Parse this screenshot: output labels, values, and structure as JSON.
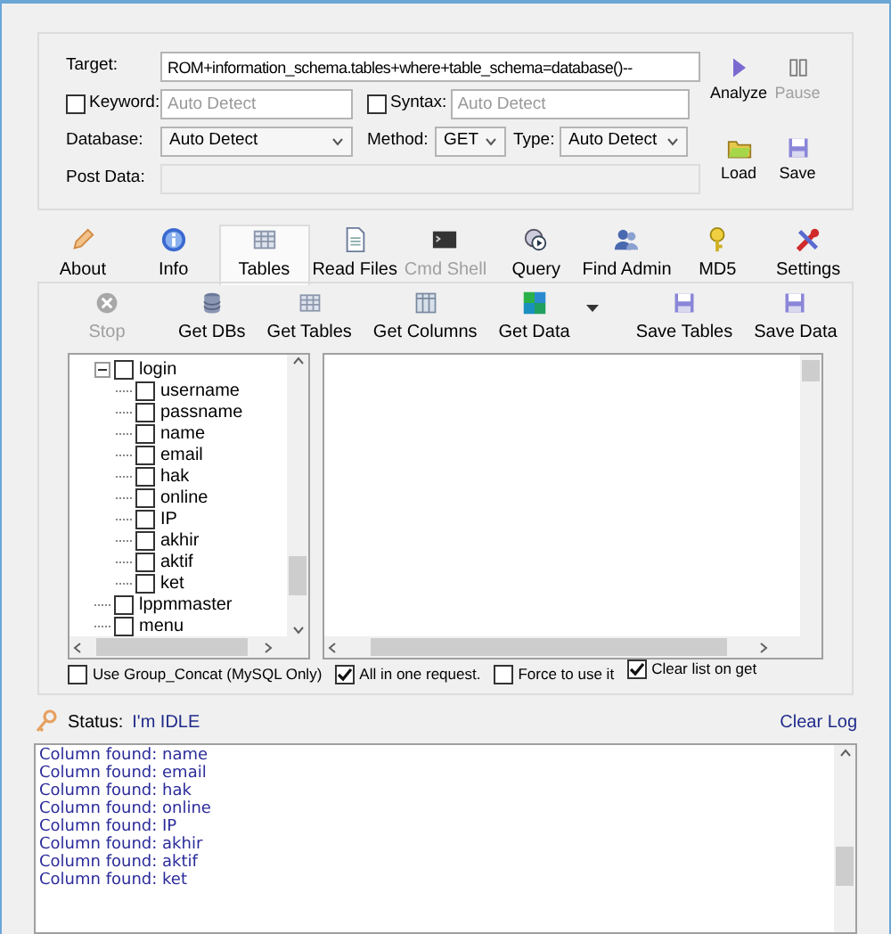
{
  "form": {
    "target": {
      "label": "Target:",
      "value": "ROM+information_schema.tables+where+table_schema=database()--"
    },
    "keyword": {
      "label": "Keyword:",
      "checked": false,
      "placeholder": "Auto Detect"
    },
    "syntax": {
      "label": "Syntax:",
      "checked": false,
      "placeholder": "Auto Detect"
    },
    "database": {
      "label": "Database:",
      "value": "Auto Detect"
    },
    "method": {
      "label": "Method:",
      "value": "GET"
    },
    "type": {
      "label": "Type:",
      "value": "Auto Detect"
    },
    "post_data": {
      "label": "Post Data:"
    }
  },
  "actions": [
    {
      "kind": "play",
      "label": "Analyze",
      "disabled": false
    },
    {
      "kind": "pause",
      "label": "Pause",
      "disabled": true
    },
    {
      "kind": "folder",
      "label": "Load",
      "disabled": false
    },
    {
      "kind": "floppy",
      "label": "Save",
      "disabled": false
    }
  ],
  "tabs": [
    {
      "kind": "about",
      "label": "About",
      "selected": false,
      "disabled": false
    },
    {
      "kind": "info",
      "label": "Info",
      "selected": false,
      "disabled": false
    },
    {
      "kind": "tables",
      "label": "Tables",
      "selected": true,
      "disabled": false
    },
    {
      "kind": "files",
      "label": "Read Files",
      "selected": false,
      "disabled": false
    },
    {
      "kind": "shell",
      "label": "Cmd Shell",
      "selected": false,
      "disabled": true
    },
    {
      "kind": "query",
      "label": "Query",
      "selected": false,
      "disabled": false
    },
    {
      "kind": "admin",
      "label": "Find Admin",
      "selected": false,
      "disabled": false
    },
    {
      "kind": "md5",
      "label": "MD5",
      "selected": false,
      "disabled": false
    },
    {
      "kind": "settings",
      "label": "Settings",
      "selected": false,
      "disabled": false
    }
  ],
  "toolbar": [
    {
      "buttons": [
        {
          "kind": "stop",
          "label": "Stop",
          "disabled": true
        }
      ]
    },
    {
      "buttons": [
        {
          "kind": "dbs",
          "label": "Get DBs",
          "disabled": false
        },
        {
          "kind": "tables",
          "label": "Get Tables",
          "disabled": false
        },
        {
          "kind": "columns",
          "label": "Get Columns",
          "disabled": false
        },
        {
          "kind": "data",
          "label": "Get Data",
          "disabled": false
        },
        {
          "kind": "dropdown",
          "disabled": false
        }
      ]
    },
    {
      "buttons": [
        {
          "kind": "floppy",
          "label": "Save Tables",
          "disabled": false
        },
        {
          "kind": "floppy",
          "label": "Save Data",
          "disabled": false
        }
      ]
    }
  ],
  "tree": [
    {
      "label": "login",
      "checked": false,
      "expanded": true,
      "children": [
        {
          "label": "username",
          "checked": false
        },
        {
          "label": "passname",
          "checked": false
        },
        {
          "label": "name",
          "checked": false
        },
        {
          "label": "email",
          "checked": false
        },
        {
          "label": "hak",
          "checked": false
        },
        {
          "label": "online",
          "checked": false
        },
        {
          "label": "IP",
          "checked": false
        },
        {
          "label": "akhir",
          "checked": false
        },
        {
          "label": "aktif",
          "checked": false
        },
        {
          "label": "ket",
          "checked": false
        }
      ]
    },
    {
      "label": "lppmmaster",
      "checked": false
    },
    {
      "label": "menu",
      "checked": false
    }
  ],
  "options": [
    {
      "label": "Use Group_Concat (MySQL Only)",
      "checked": false
    },
    {
      "label": "All in one request.",
      "checked": true
    },
    {
      "label": "Force to use it",
      "checked": false
    },
    {
      "label": "Clear list on get",
      "checked": true
    }
  ],
  "status": {
    "label": "Status:",
    "value": "I'm IDLE"
  },
  "clear_log": "Clear Log",
  "log": [
    "Column found: name",
    "Column found: email",
    "Column found: hak",
    "Column found: online",
    "Column found: IP",
    "Column found: akhir",
    "Column found: aktif",
    "Column found: ket"
  ]
}
